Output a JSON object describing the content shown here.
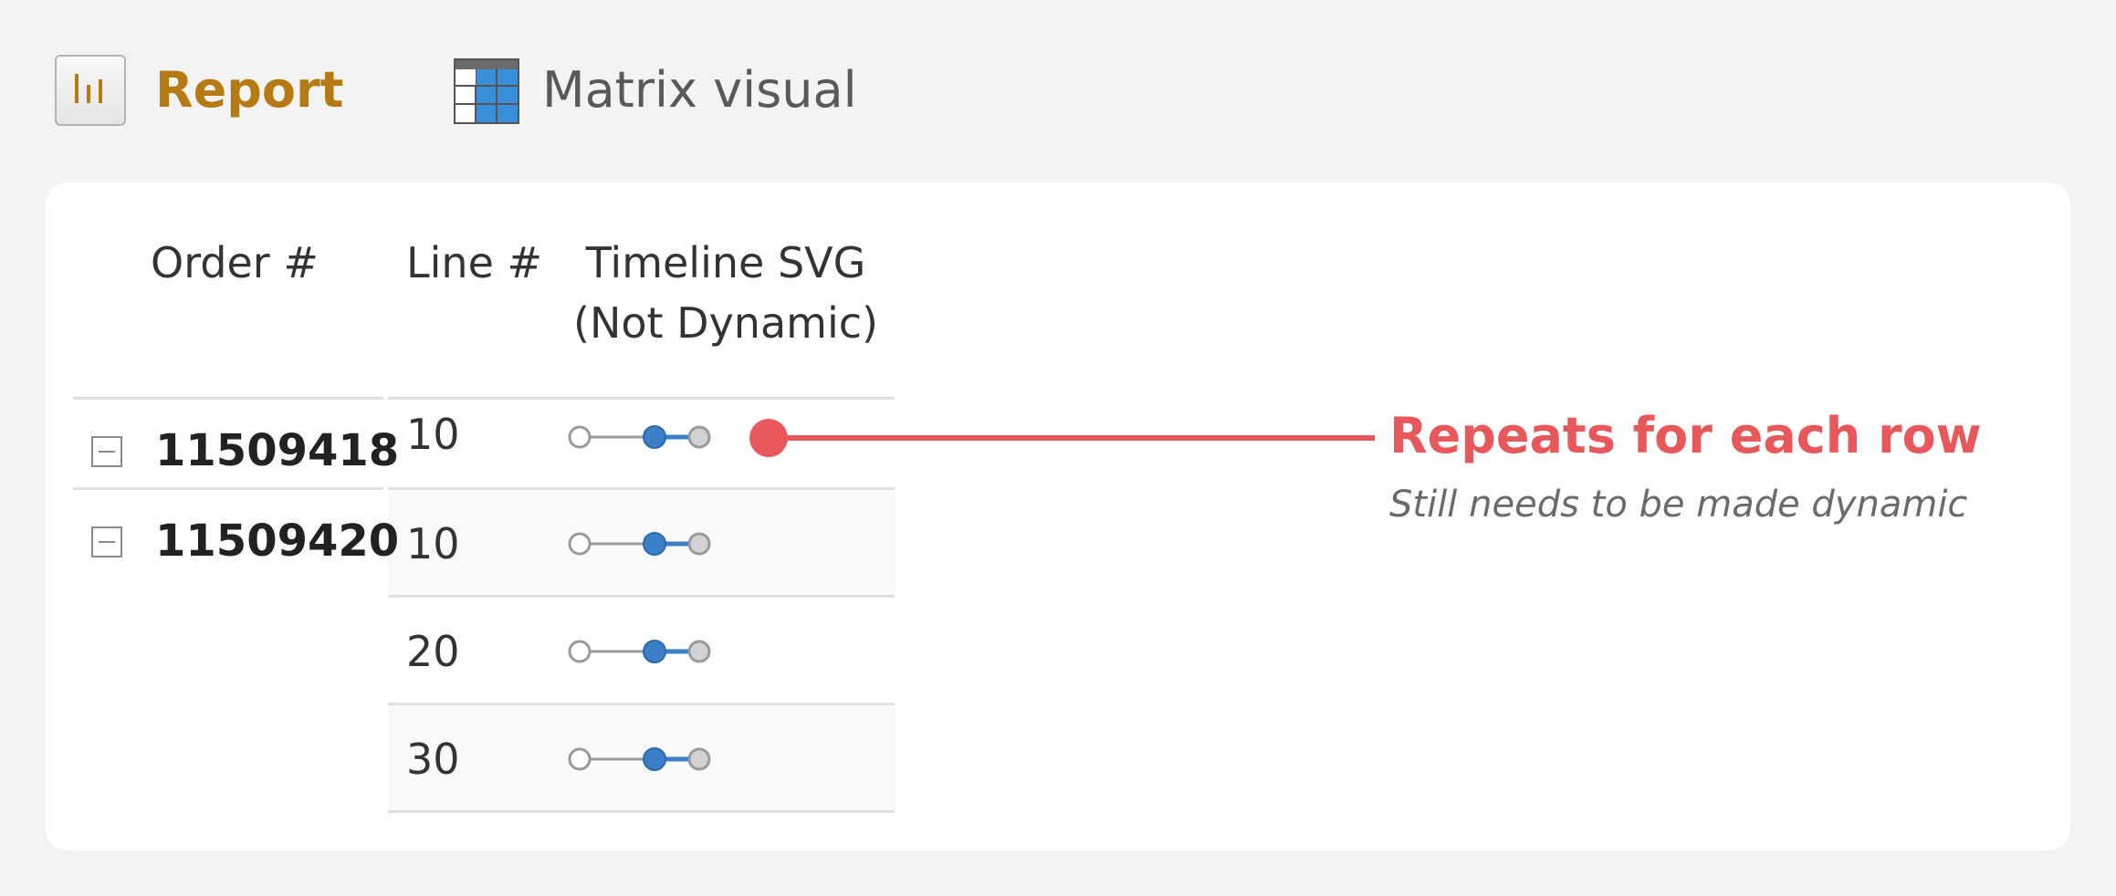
{
  "header": {
    "report_label": "Report",
    "visual_label": "Matrix visual",
    "report_color": "#b57b12"
  },
  "matrix": {
    "columns": {
      "order": "Order #",
      "line": "Line #",
      "timeline_line1": "Timeline SVG",
      "timeline_line2": "(Not Dynamic)"
    },
    "orders": [
      {
        "order": "11509418"
      },
      {
        "order": "11509420"
      }
    ],
    "rows": [
      {
        "line": "10"
      },
      {
        "line": "10"
      },
      {
        "line": "20"
      },
      {
        "line": "30"
      }
    ],
    "timeline_accent": "#3a7fc8"
  },
  "callout": {
    "title": "Repeats for each row",
    "subtitle": "Still needs to be made dynamic",
    "color": "#e8585b"
  }
}
